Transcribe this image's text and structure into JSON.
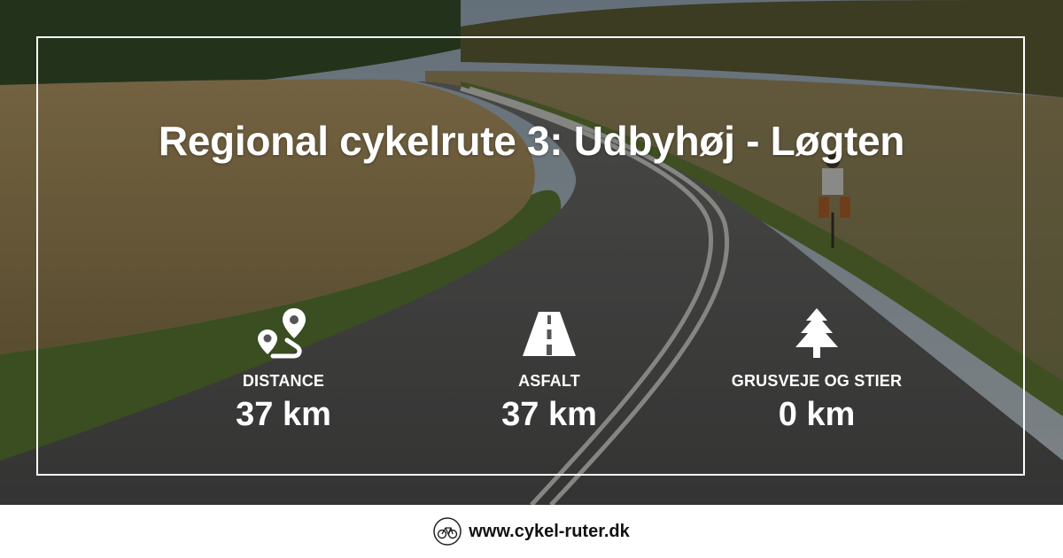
{
  "hero": {
    "title": "Regional cykelrute 3: Udbyhøj - Løgten"
  },
  "stats": [
    {
      "icon": "route-icon",
      "label": "DISTANCE",
      "value": "37 km"
    },
    {
      "icon": "road-icon",
      "label": "ASFALT",
      "value": "37 km"
    },
    {
      "icon": "tree-icon",
      "label": "GRUSVEJE OG STIER",
      "value": "0 km"
    }
  ],
  "footer": {
    "site": "www.cykel-ruter.dk",
    "icon": "bicycle-logo-icon"
  },
  "colors": {
    "text": "#ffffff",
    "overlay": "rgba(20,20,20,0.42)",
    "footer_bg": "#ffffff",
    "footer_text": "#111111"
  }
}
